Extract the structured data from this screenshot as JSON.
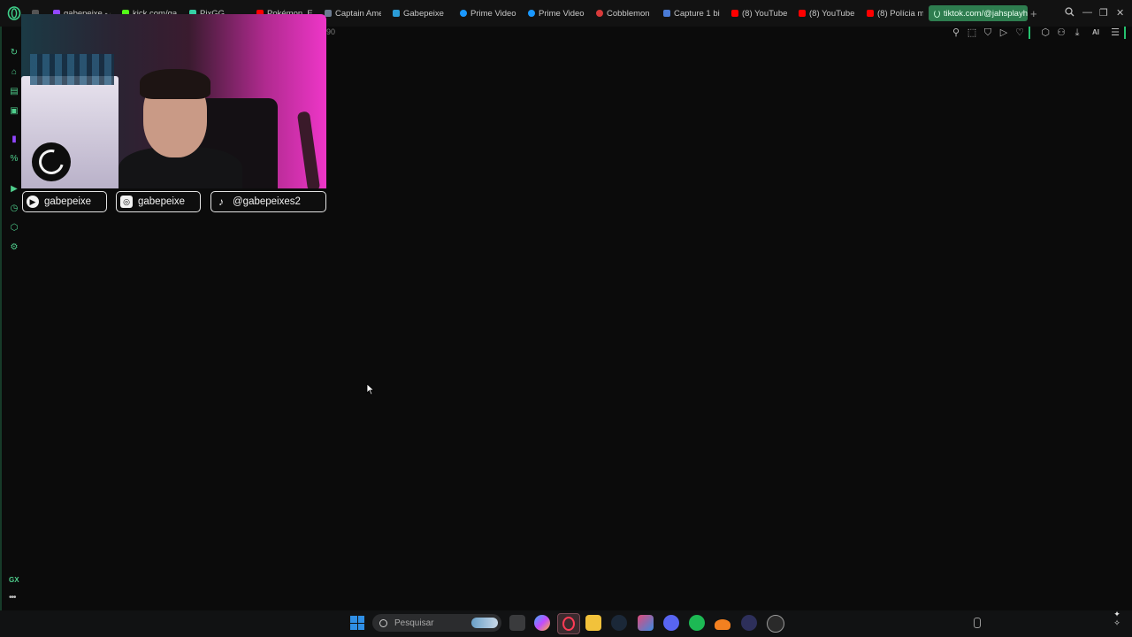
{
  "browser": {
    "tabs": [
      {
        "label": "gabepeixe - (",
        "fav_color": "#9146ff"
      },
      {
        "label": "kick.com/gab",
        "fav_color": "#53fc18"
      },
      {
        "label": "PixGG",
        "fav_color": "#35d0a5"
      },
      {
        "label": "Pokémon_Eu",
        "fav_color": "#ff0000"
      },
      {
        "label": "Captain Amer",
        "fav_color": "#6b7a8f"
      },
      {
        "label": "Gabepeixe",
        "fav_color": "#2a9bd6"
      },
      {
        "label": "Prime Video:",
        "fav_color": "#1a98ff"
      },
      {
        "label": "Prime Video:",
        "fav_color": "#1a98ff"
      },
      {
        "label": "Cobblemon F",
        "fav_color": "#d83a3a"
      },
      {
        "label": "Capture 1 billi",
        "fav_color": "#4a7bd6"
      },
      {
        "label": "(8) YouTube",
        "fav_color": "#ff0000"
      },
      {
        "label": "(8) YouTube",
        "fav_color": "#ff0000"
      },
      {
        "label": "(8) Polícia mo",
        "fav_color": "#ff0000"
      }
    ],
    "active_tab": {
      "label": "tiktok.com/@jahsplayh",
      "fav_color": "#2e7d4f"
    },
    "url_fragment": "90"
  },
  "toolbar": {
    "ai_label": "AI"
  },
  "sidebar": {
    "gx_label": "GX",
    "more_label": "•••"
  },
  "overlay": {
    "socials": [
      {
        "platform": "youtube",
        "icon": "youtube-icon",
        "glyph": "▶",
        "handle": "gabepeixe"
      },
      {
        "platform": "instagram",
        "icon": "instagram-icon",
        "glyph": "◎",
        "handle": "gabepeixe"
      },
      {
        "platform": "tiktok",
        "icon": "tiktok-icon",
        "glyph": "♪",
        "handle": "@gabepeixes2"
      }
    ]
  },
  "taskbar": {
    "search_placeholder": "Pesquisar"
  },
  "colors": {
    "accent": "#25c16f",
    "active_tab_bg": "#2e7d4f",
    "page_bg": "#0b0b0b"
  }
}
